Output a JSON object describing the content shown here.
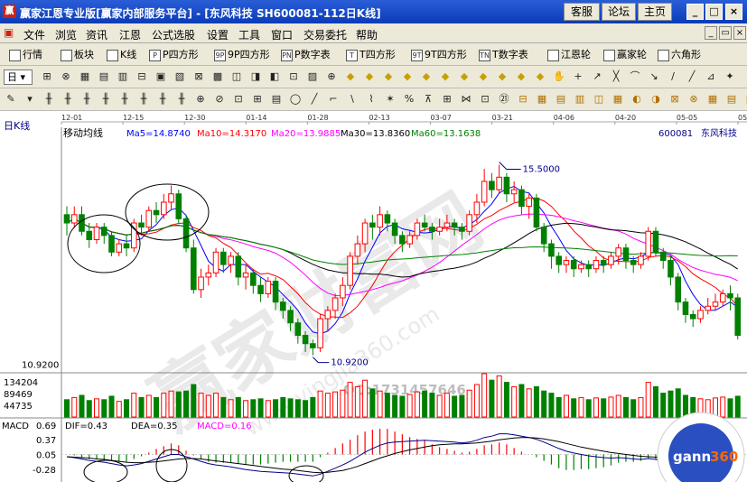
{
  "titlebar": {
    "title": "赢家江恩专业版[赢家内部服务平台] - [东风科技   SH600081-112日K线]",
    "btn_kefu": "客服",
    "btn_luntan": "论坛",
    "btn_zhuye": "主页"
  },
  "menu": [
    "文件",
    "浏览",
    "资讯",
    "江恩",
    "公式选股",
    "设置",
    "工具",
    "窗口",
    "交易委托",
    "帮助"
  ],
  "toolbar1": [
    {
      "label": "行情",
      "icon": "grid-icon"
    },
    {
      "label": "板块",
      "icon": "blocks-icon"
    },
    {
      "label": "K线",
      "icon": "candle-icon"
    },
    {
      "label": "P四方形",
      "icon": "P"
    },
    {
      "label": "9P四方形",
      "icon": "9P"
    },
    {
      "label": "P数字表",
      "icon": "PN"
    },
    {
      "label": "T四方形",
      "icon": "T"
    },
    {
      "label": "9T四方形",
      "icon": "9T"
    },
    {
      "label": "T数字表",
      "icon": "TN"
    },
    {
      "label": "江恩轮",
      "icon": "wheel-icon"
    },
    {
      "label": "赢家轮",
      "icon": "wheel-icon"
    },
    {
      "label": "六角形",
      "icon": "hexagon-icon"
    }
  ],
  "period_select": "日",
  "chart_data": {
    "type": "candlestick",
    "period": "日K线",
    "ma_title": "移动均线",
    "ma": [
      {
        "name": "Ma5=14.8740",
        "color": "#0000ff"
      },
      {
        "name": "Ma10=14.3170",
        "color": "#ff0000"
      },
      {
        "name": "Ma20=13.9885",
        "color": "#ff00ff"
      },
      {
        "name": "Ma30=13.8360",
        "color": "#000000"
      },
      {
        "name": "Ma60=13.1638",
        "color": "#008000"
      }
    ],
    "stock_code": "600081",
    "stock_name": "东风科技",
    "date_ticks": [
      "12-01",
      "12-15",
      "12-30",
      "01-14",
      "01-28",
      "02-13",
      "03-07",
      "03-21",
      "04-06",
      "04-20",
      "05-05",
      "05-19"
    ],
    "ylim": [
      10.5,
      16.4
    ],
    "high_label": "15.5000",
    "low_label": "10.9200",
    "low_axis": "10.9200",
    "volume_ticks": [
      "134204",
      "89469",
      "44735"
    ],
    "watermark_qq": "QQ:1731457646",
    "watermark_main": "赢家财富网",
    "watermark_url": "www.yingjia360.com",
    "candles": [
      [
        14.3,
        14.1,
        14.5,
        13.8
      ],
      [
        14.1,
        14.3,
        14.5,
        14.0
      ],
      [
        14.3,
        13.9,
        14.5,
        13.8
      ],
      [
        13.9,
        13.7,
        14.1,
        13.5
      ],
      [
        13.7,
        14.0,
        14.1,
        13.6
      ],
      [
        14.0,
        13.8,
        14.1,
        13.6
      ],
      [
        13.8,
        13.4,
        13.9,
        13.3
      ],
      [
        13.4,
        13.6,
        13.7,
        13.3
      ],
      [
        13.6,
        13.5,
        13.8,
        13.3
      ],
      [
        13.5,
        14.1,
        14.2,
        13.4
      ],
      [
        14.1,
        14.0,
        14.3,
        13.8
      ],
      [
        14.0,
        14.4,
        14.5,
        13.9
      ],
      [
        14.4,
        14.3,
        14.6,
        14.1
      ],
      [
        14.3,
        14.6,
        14.8,
        14.2
      ],
      [
        14.6,
        14.8,
        15.0,
        14.4
      ],
      [
        14.8,
        14.2,
        14.9,
        14.1
      ],
      [
        14.2,
        13.5,
        14.3,
        13.4
      ],
      [
        13.5,
        12.5,
        13.7,
        12.4
      ],
      [
        12.5,
        12.8,
        13.0,
        12.3
      ],
      [
        12.8,
        12.9,
        13.1,
        12.6
      ],
      [
        12.9,
        13.4,
        13.5,
        12.8
      ],
      [
        13.4,
        13.1,
        13.5,
        12.9
      ],
      [
        13.1,
        13.3,
        13.4,
        12.9
      ],
      [
        13.3,
        12.8,
        13.4,
        12.6
      ],
      [
        12.8,
        12.9,
        13.1,
        12.5
      ],
      [
        12.9,
        12.6,
        13.0,
        12.4
      ],
      [
        12.6,
        12.4,
        12.8,
        12.2
      ],
      [
        12.4,
        12.7,
        12.8,
        12.3
      ],
      [
        12.7,
        12.2,
        12.8,
        12.0
      ],
      [
        12.2,
        12.0,
        12.3,
        11.8
      ],
      [
        12.0,
        11.7,
        12.1,
        11.5
      ],
      [
        11.7,
        11.4,
        11.8,
        11.2
      ],
      [
        11.4,
        11.2,
        11.5,
        11.0
      ],
      [
        11.2,
        11.1,
        11.3,
        10.92
      ],
      [
        11.1,
        11.8,
        11.9,
        11.0
      ],
      [
        11.8,
        12.0,
        12.1,
        11.5
      ],
      [
        12.0,
        12.3,
        12.4,
        11.8
      ],
      [
        12.3,
        12.6,
        12.8,
        12.1
      ],
      [
        12.6,
        13.3,
        13.4,
        12.5
      ],
      [
        13.3,
        13.6,
        13.8,
        13.1
      ],
      [
        13.6,
        14.1,
        14.2,
        13.4
      ],
      [
        14.1,
        14.0,
        14.3,
        13.7
      ],
      [
        14.0,
        14.3,
        14.5,
        13.8
      ],
      [
        14.3,
        14.1,
        14.4,
        13.9
      ],
      [
        14.1,
        13.8,
        14.2,
        13.6
      ],
      [
        13.8,
        13.6,
        13.9,
        13.4
      ],
      [
        13.6,
        13.8,
        13.9,
        13.5
      ],
      [
        13.8,
        14.1,
        14.2,
        13.7
      ],
      [
        14.1,
        14.0,
        14.3,
        13.9
      ],
      [
        14.0,
        13.9,
        14.1,
        13.7
      ],
      [
        13.9,
        14.0,
        14.2,
        13.8
      ],
      [
        14.0,
        14.1,
        14.3,
        13.9
      ],
      [
        14.1,
        14.0,
        14.2,
        13.8
      ],
      [
        14.0,
        13.9,
        14.1,
        13.7
      ],
      [
        13.9,
        14.3,
        14.4,
        13.8
      ],
      [
        14.3,
        14.6,
        14.8,
        14.1
      ],
      [
        14.6,
        15.1,
        15.4,
        14.5
      ],
      [
        15.1,
        14.9,
        15.3,
        14.7
      ],
      [
        14.9,
        15.2,
        15.5,
        14.8
      ],
      [
        15.2,
        14.8,
        15.3,
        14.6
      ],
      [
        14.8,
        14.9,
        15.1,
        14.6
      ],
      [
        14.9,
        14.5,
        15.0,
        14.3
      ],
      [
        14.5,
        14.7,
        14.8,
        14.2
      ],
      [
        14.7,
        14.0,
        14.8,
        13.9
      ],
      [
        14.0,
        13.6,
        14.1,
        13.4
      ],
      [
        13.6,
        13.3,
        13.7,
        13.0
      ],
      [
        13.3,
        13.1,
        13.4,
        12.9
      ],
      [
        13.1,
        13.2,
        13.3,
        12.9
      ],
      [
        13.2,
        13.0,
        13.3,
        12.8
      ],
      [
        13.0,
        13.1,
        13.2,
        12.9
      ],
      [
        13.1,
        13.0,
        13.2,
        12.8
      ],
      [
        13.0,
        13.2,
        13.3,
        12.9
      ],
      [
        13.2,
        13.1,
        13.3,
        12.9
      ],
      [
        13.1,
        13.3,
        13.4,
        13.0
      ],
      [
        13.3,
        13.5,
        13.6,
        13.1
      ],
      [
        13.5,
        13.2,
        13.6,
        13.0
      ],
      [
        13.2,
        13.1,
        13.3,
        12.9
      ],
      [
        13.1,
        13.3,
        13.4,
        13.0
      ],
      [
        13.3,
        13.9,
        14.0,
        13.2
      ],
      [
        13.9,
        13.4,
        14.0,
        13.3
      ],
      [
        13.4,
        13.2,
        13.5,
        13.0
      ],
      [
        13.2,
        12.8,
        13.3,
        12.6
      ],
      [
        12.8,
        12.2,
        12.9,
        12.0
      ],
      [
        12.2,
        11.9,
        12.3,
        11.7
      ],
      [
        11.9,
        11.8,
        12.0,
        11.6
      ],
      [
        11.8,
        12.0,
        12.1,
        11.7
      ],
      [
        12.0,
        12.1,
        12.3,
        11.9
      ],
      [
        12.1,
        12.2,
        12.4,
        12.0
      ],
      [
        12.2,
        12.4,
        12.5,
        12.1
      ],
      [
        12.4,
        12.3,
        12.6,
        12.0
      ],
      [
        12.3,
        11.4,
        12.4,
        11.3
      ]
    ],
    "volumes": [
      40,
      45,
      50,
      38,
      42,
      40,
      48,
      36,
      40,
      55,
      45,
      50,
      45,
      55,
      60,
      58,
      60,
      75,
      55,
      50,
      55,
      45,
      40,
      45,
      38,
      40,
      42,
      38,
      40,
      45,
      42,
      40,
      38,
      45,
      60,
      55,
      58,
      62,
      80,
      70,
      85,
      65,
      60,
      55,
      50,
      48,
      52,
      58,
      60,
      55,
      50,
      55,
      48,
      50,
      62,
      75,
      100,
      85,
      95,
      80,
      70,
      75,
      65,
      70,
      60,
      55,
      45,
      50,
      42,
      45,
      40,
      44,
      42,
      46,
      50,
      45,
      40,
      45,
      80,
      70,
      55,
      60,
      65,
      50,
      45,
      42,
      40,
      44,
      46,
      42,
      48
    ],
    "macd": {
      "label": "MACD",
      "dif": "DIF=0.43",
      "dea": "DEA=0.35",
      "macd_val": "MACD=0.16",
      "ticks": [
        "0.69",
        "0.37",
        "0.05",
        "-0.28"
      ],
      "dif_series": [
        0.0,
        -0.02,
        -0.05,
        -0.08,
        -0.1,
        -0.12,
        -0.15,
        -0.18,
        -0.2,
        -0.18,
        -0.15,
        -0.1,
        -0.05,
        0.0,
        0.05,
        0.05,
        0.0,
        -0.05,
        -0.1,
        -0.15,
        -0.18,
        -0.2,
        -0.22,
        -0.25,
        -0.28,
        -0.3,
        -0.32,
        -0.33,
        -0.34,
        -0.35,
        -0.36,
        -0.38,
        -0.4,
        -0.42,
        -0.38,
        -0.32,
        -0.25,
        -0.18,
        -0.1,
        0.0,
        0.1,
        0.18,
        0.25,
        0.3,
        0.32,
        0.33,
        0.34,
        0.35,
        0.36,
        0.35,
        0.34,
        0.33,
        0.32,
        0.3,
        0.32,
        0.36,
        0.42,
        0.45,
        0.5,
        0.5,
        0.48,
        0.45,
        0.42,
        0.38,
        0.32,
        0.25,
        0.18,
        0.12,
        0.08,
        0.05,
        0.02,
        0.0,
        -0.02,
        -0.03,
        -0.02,
        -0.03,
        -0.05,
        -0.06,
        -0.04,
        -0.06,
        -0.1,
        -0.15,
        -0.2,
        -0.25,
        -0.28,
        -0.3,
        -0.28,
        -0.26,
        -0.24,
        -0.25,
        -0.3
      ],
      "dea_series": [
        0.0,
        -0.01,
        -0.02,
        -0.03,
        -0.05,
        -0.06,
        -0.08,
        -0.1,
        -0.12,
        -0.13,
        -0.13,
        -0.12,
        -0.11,
        -0.09,
        -0.07,
        -0.05,
        -0.04,
        -0.04,
        -0.05,
        -0.07,
        -0.09,
        -0.11,
        -0.13,
        -0.15,
        -0.17,
        -0.19,
        -0.21,
        -0.23,
        -0.25,
        -0.27,
        -0.28,
        -0.3,
        -0.32,
        -0.34,
        -0.35,
        -0.34,
        -0.32,
        -0.3,
        -0.26,
        -0.21,
        -0.15,
        -0.09,
        -0.03,
        0.02,
        0.07,
        0.11,
        0.15,
        0.18,
        0.21,
        0.24,
        0.26,
        0.27,
        0.28,
        0.28,
        0.29,
        0.3,
        0.32,
        0.34,
        0.37,
        0.39,
        0.41,
        0.42,
        0.42,
        0.41,
        0.39,
        0.36,
        0.33,
        0.29,
        0.25,
        0.21,
        0.18,
        0.15,
        0.12,
        0.09,
        0.07,
        0.05,
        0.03,
        0.01,
        0.0,
        -0.01,
        -0.03,
        -0.05,
        -0.08,
        -0.11,
        -0.14,
        -0.17,
        -0.19,
        -0.2,
        -0.21,
        -0.22,
        -0.23
      ]
    }
  },
  "logo": {
    "text": "gann",
    "num": "360"
  }
}
